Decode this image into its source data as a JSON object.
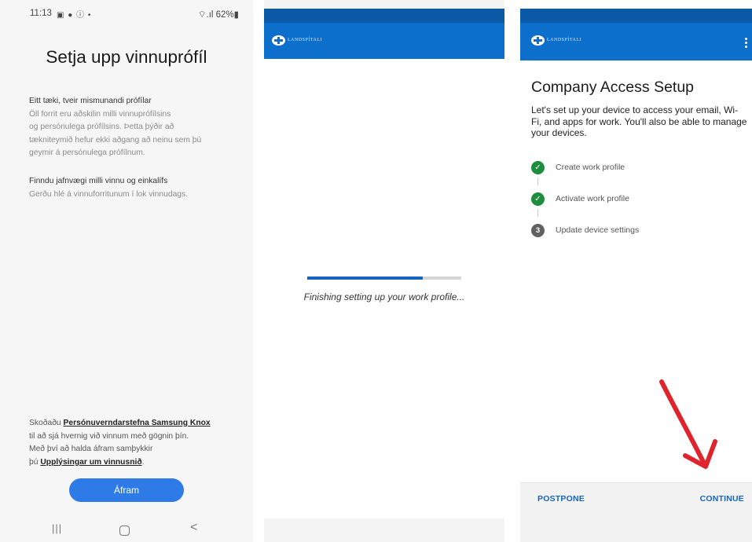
{
  "samsung": {
    "status": {
      "time": "11:13",
      "left_icons": "▣ ● ⓘ •",
      "right": "⌔.ıl 62%▮"
    },
    "title": "Setja upp vinnuprófíl",
    "section1": {
      "heading": "Eitt tæki, tveir mismunandi prófílar",
      "lines": [
        "Öll forrit eru aðskilin milli vinnuprófílsins",
        "og persónulega prófílsins. Þetta þýðir að",
        "tækniteymið hefur ekki aðgang að neinu sem þú",
        "geymir á persónulega prófílnum."
      ]
    },
    "section2": {
      "heading": "Finndu jafnvægi milli vinnu og einkalífs",
      "lines": [
        "Gerðu hlé á vinnuforritunum í lok vinnudags."
      ]
    },
    "legal": {
      "prefix": "Skoðaðu",
      "link1": "Persónuverndarstefna Samsung Knox",
      "line2": "til að sjá hvernig við vinnum með gögnin þín.",
      "line3": "Með því að halda áfram samþykkir",
      "line4_prefix": "þú",
      "link2": "Upplýsingar um vinnusnið",
      "line4_suffix": "."
    },
    "continue_button": "Áfram",
    "nav": {
      "recent": "|||",
      "back": "<"
    }
  },
  "intune_progress": {
    "brand": "LANDSPÍTALI",
    "progress_fraction": 0.75,
    "message": "Finishing setting up your work profile..."
  },
  "company_portal": {
    "brand": "LANDSPÍTALI",
    "title": "Company Access Setup",
    "description": "Let's set up your device to access your email, Wi-Fi, and apps for work. You'll also be able to manage your devices.",
    "steps": [
      {
        "status": "done",
        "label": "Create work profile"
      },
      {
        "status": "done",
        "label": "Activate work profile"
      },
      {
        "status": "current",
        "number": "3",
        "label": "Update device settings"
      }
    ],
    "postpone": "POSTPONE",
    "continue": "CONTINUE",
    "annotation_color": "#e0242c"
  },
  "colors": {
    "brand_blue": "#0b6fcb",
    "brand_blue_dark": "#0a5aa8",
    "samsung_button": "#2e7ae6",
    "check_green": "#1e8e3e",
    "link_blue": "#1565c0"
  }
}
